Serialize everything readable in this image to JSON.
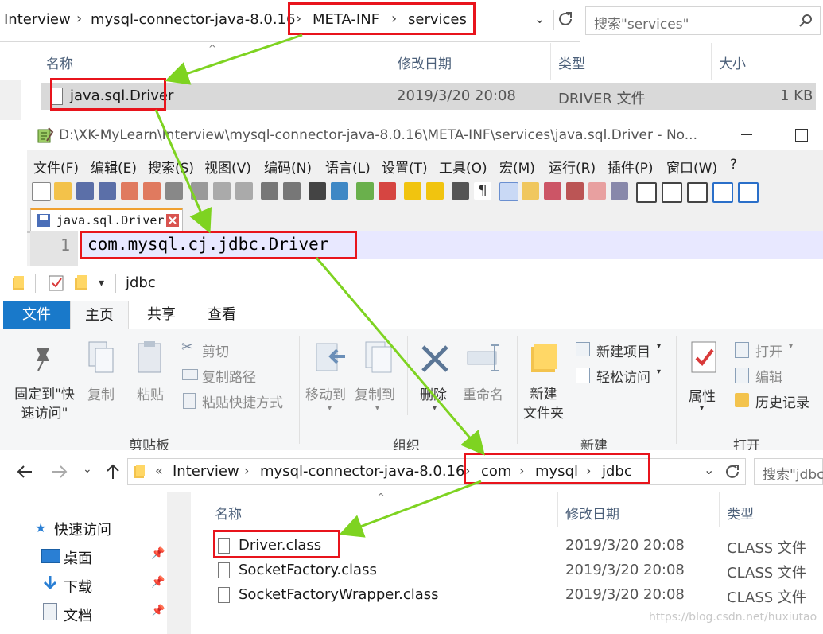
{
  "top_explorer": {
    "breadcrumb": [
      "Interview",
      "mysql-connector-java-8.0.16",
      "META-INF",
      "services"
    ],
    "search_placeholder": "搜索\"services\"",
    "columns": [
      "名称",
      "修改日期",
      "类型",
      "大小"
    ],
    "row": {
      "name": "java.sql.Driver",
      "date": "2019/3/20 20:08",
      "type": "DRIVER 文件",
      "size": "1 KB"
    }
  },
  "notepad": {
    "title": "D:\\XK-MyLearn\\Interview\\mysql-connector-java-8.0.16\\META-INF\\services\\java.sql.Driver - No...",
    "menu": [
      "文件(F)",
      "编辑(E)",
      "搜索(S)",
      "视图(V)",
      "编码(N)",
      "语言(L)",
      "设置(T)",
      "工具(O)",
      "宏(M)",
      "运行(R)",
      "插件(P)",
      "窗口(W)",
      "?"
    ],
    "tab_label": "java.sql.Driver",
    "line_number": "1",
    "line_text": "com.mysql.cj.jdbc.Driver"
  },
  "bottom_explorer": {
    "title": "jdbc",
    "tabs": [
      "文件",
      "主页",
      "共享",
      "查看"
    ],
    "ribbon": {
      "pin_label": "固定到\"快\n速访问\"",
      "copy": "复制",
      "paste": "粘贴",
      "cut": "剪切",
      "copy_path": "复制路径",
      "paste_shortcut": "粘贴快捷方式",
      "group_clipboard": "剪贴板",
      "move_to": "移动到",
      "copy_to": "复制到",
      "delete": "删除",
      "rename": "重命名",
      "group_organize": "组织",
      "new_item": "新建项目",
      "easy_access": "轻松访问",
      "new_folder": "新建\n文件夹",
      "group_new": "新建",
      "properties": "属性",
      "open": "打开",
      "edit": "编辑",
      "history": "历史记录",
      "group_open": "打开"
    },
    "breadcrumb_prefix": "«",
    "breadcrumb": [
      "Interview",
      "mysql-connector-java-8.0.16",
      "com",
      "mysql",
      "jdbc"
    ],
    "search_placeholder": "搜索\"jdbc",
    "nav": [
      "快速访问",
      "桌面",
      "下载",
      "文档"
    ],
    "columns": [
      "名称",
      "修改日期",
      "类型"
    ],
    "files": [
      {
        "name": "Driver.class",
        "date": "2019/3/20 20:08",
        "type": "CLASS 文件"
      },
      {
        "name": "SocketFactory.class",
        "date": "2019/3/20 20:08",
        "type": "CLASS 文件"
      },
      {
        "name": "SocketFactoryWrapper.class",
        "date": "2019/3/20 20:08",
        "type": "CLASS 文件"
      }
    ]
  },
  "watermark": "https://blog.csdn.net/huxiutao",
  "colors": {
    "highlight_box": "#e8141c",
    "arrow": "#7ed321",
    "ribbon_file_tab": "#1979ca"
  }
}
